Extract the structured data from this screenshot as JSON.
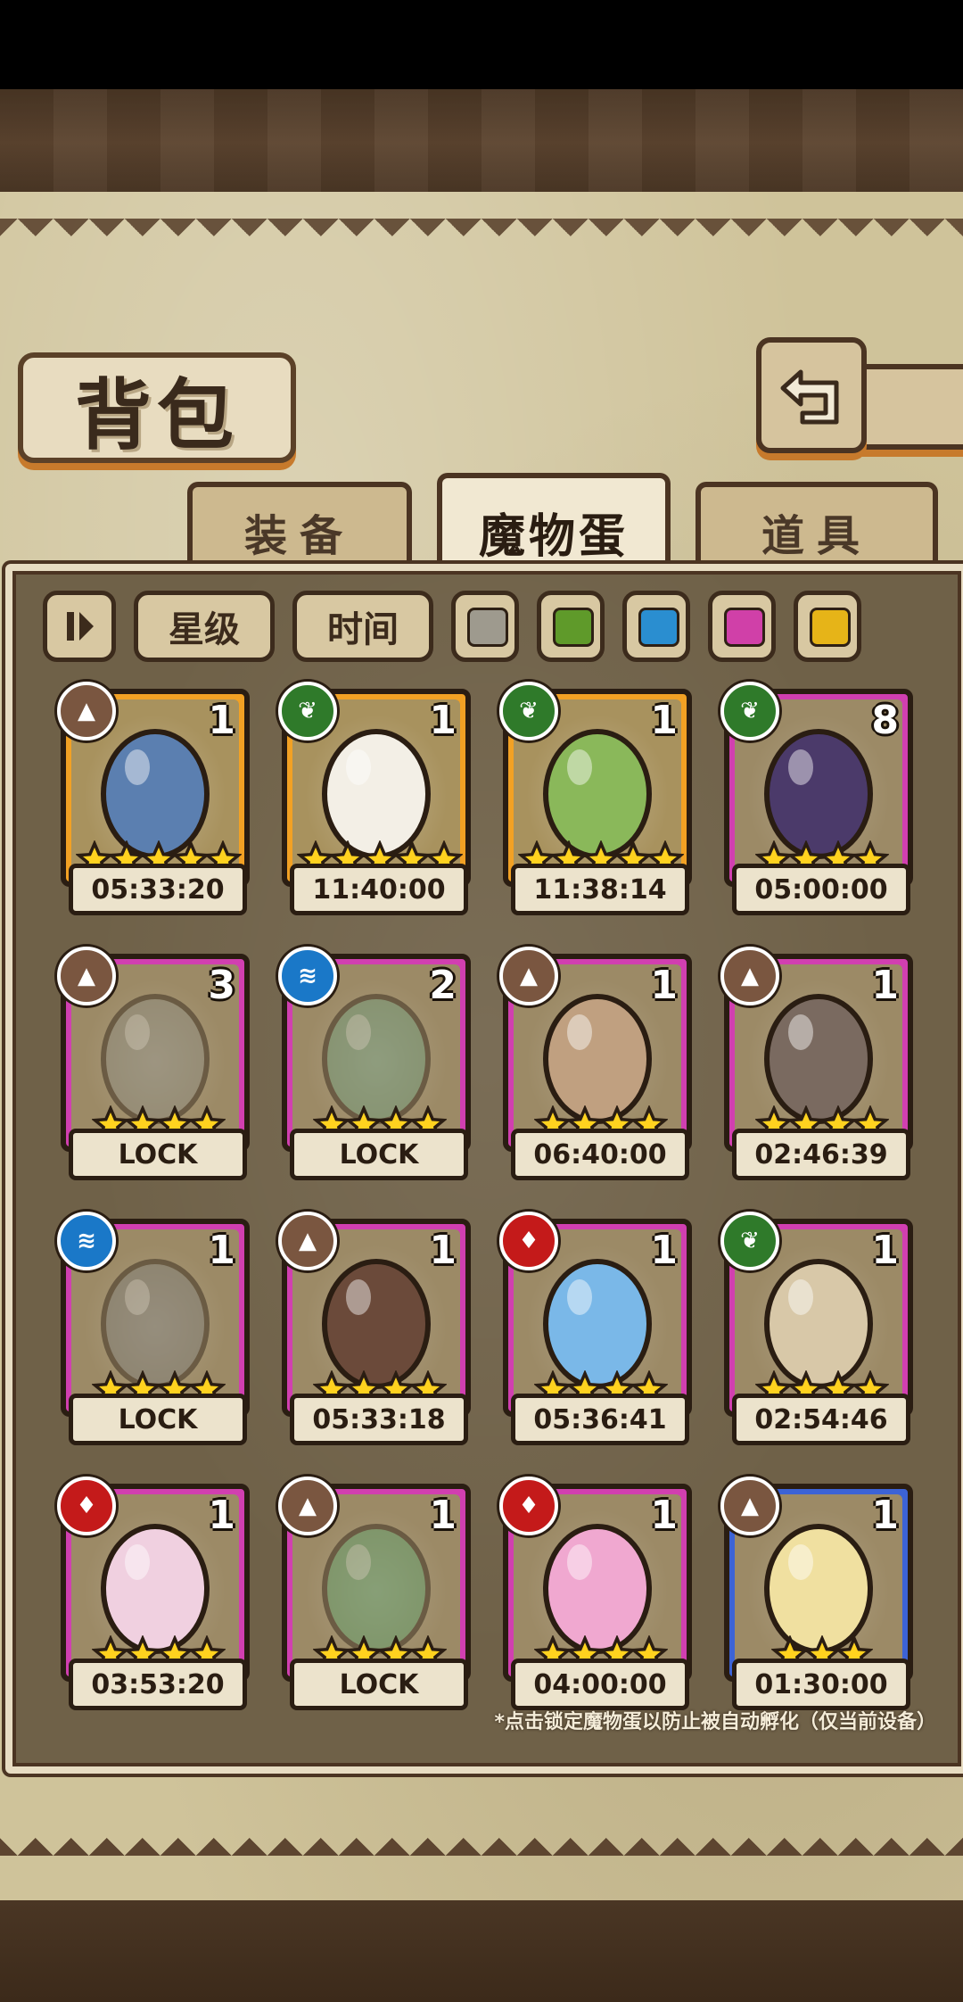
{
  "header": {
    "title": "背包"
  },
  "tabs": [
    {
      "label": "装备",
      "active": false
    },
    {
      "label": "魔物蛋",
      "active": true
    },
    {
      "label": "道具",
      "active": false
    }
  ],
  "filters": {
    "sort_icon": "sort-toggle-icon",
    "star_label": "星级",
    "time_label": "时间",
    "colors": [
      "#9e9a8e",
      "#5f9a2a",
      "#2a8ed0",
      "#d040a8",
      "#e6b418"
    ]
  },
  "eggs": [
    {
      "count": "1",
      "stars": 5,
      "rarity": "gold",
      "element": "earth",
      "timer": "05:33:20",
      "icon": "hammer-icon"
    },
    {
      "count": "1",
      "stars": 5,
      "rarity": "gold",
      "element": "grass",
      "timer": "11:40:00",
      "icon": "angel-egg-icon"
    },
    {
      "count": "1",
      "stars": 5,
      "rarity": "gold",
      "element": "grass",
      "timer": "11:38:14",
      "icon": "green-egg-icon"
    },
    {
      "count": "8",
      "stars": 4,
      "rarity": "purple",
      "element": "grass",
      "timer": "05:00:00",
      "icon": "dark-flower-icon"
    },
    {
      "count": "3",
      "stars": 4,
      "rarity": "purple",
      "element": "earth",
      "timer": "LOCK",
      "icon": "sword-egg-icon"
    },
    {
      "count": "2",
      "stars": 4,
      "rarity": "purple",
      "element": "water",
      "timer": "LOCK",
      "icon": "bubble-creature-icon"
    },
    {
      "count": "1",
      "stars": 4,
      "rarity": "purple",
      "element": "earth",
      "timer": "06:40:00",
      "icon": "vine-egg-icon"
    },
    {
      "count": "1",
      "stars": 4,
      "rarity": "purple",
      "element": "earth",
      "timer": "02:46:39",
      "icon": "gear-egg-icon"
    },
    {
      "count": "1",
      "stars": 4,
      "rarity": "purple",
      "element": "water",
      "timer": "LOCK",
      "icon": "drill-egg-icon"
    },
    {
      "count": "1",
      "stars": 4,
      "rarity": "purple",
      "element": "earth",
      "timer": "05:33:18",
      "icon": "bow-egg-icon"
    },
    {
      "count": "1",
      "stars": 4,
      "rarity": "purple",
      "element": "fire",
      "timer": "05:36:41",
      "icon": "crystal-ring-icon"
    },
    {
      "count": "1",
      "stars": 4,
      "rarity": "purple",
      "element": "grass",
      "timer": "02:54:46",
      "icon": "striped-egg-icon"
    },
    {
      "count": "1",
      "stars": 4,
      "rarity": "purple",
      "element": "fire",
      "timer": "03:53:20",
      "icon": "bat-egg-icon"
    },
    {
      "count": "1",
      "stars": 4,
      "rarity": "purple",
      "element": "earth",
      "timer": "LOCK",
      "icon": "green-orb-icon"
    },
    {
      "count": "1",
      "stars": 4,
      "rarity": "purple",
      "element": "fire",
      "timer": "04:00:00",
      "icon": "pink-flame-icon"
    },
    {
      "count": "1",
      "stars": 3,
      "rarity": "blue",
      "element": "earth",
      "timer": "01:30:00",
      "icon": "spotted-egg-icon"
    }
  ],
  "footnote": "*点击锁定魔物蛋以防止被自动孵化（仅当前设备）"
}
